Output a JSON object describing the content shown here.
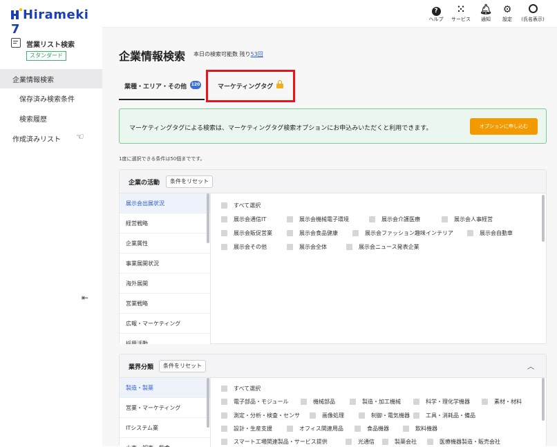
{
  "app": {
    "logo": "Hirameki 7"
  },
  "sidebar": {
    "title": "営業リスト検索",
    "badge": "スタンダード",
    "items": [
      {
        "label": "企業情報検索"
      },
      {
        "label": "保存済み検索条件"
      },
      {
        "label": "検索履歴"
      },
      {
        "label": "作成済みリスト"
      }
    ],
    "collapse_icon": "collapse-left-icon"
  },
  "topbar": {
    "items": [
      {
        "label": "ヘルプ",
        "icon": "help-icon"
      },
      {
        "label": "サービス",
        "icon": "grid-icon"
      },
      {
        "label": "通知",
        "icon": "bell-icon"
      },
      {
        "label": "設定",
        "icon": "gear-icon"
      },
      {
        "label": "(氏名表示)",
        "icon": "user-icon"
      }
    ]
  },
  "page": {
    "title": "企業情報検索",
    "quota_label": "本日の検索可能数 残り",
    "quota_value": "53回"
  },
  "tabs": [
    {
      "label": "業種・エリア・その他",
      "badge": "120"
    },
    {
      "label": "マーケティングタグ",
      "icon": "lock-icon"
    }
  ],
  "notice": {
    "text": "マーケティングタグによる検索は、マーケティングタグ検索オプションにお申込みいただくと利用できます。",
    "button": "オプションに申し込む"
  },
  "limit_note": "1度に選択できる条件は50個までです。",
  "panels": [
    {
      "title": "企業の活動",
      "reset": "条件をリセット",
      "categories": [
        "展示会出展状況",
        "経営戦略",
        "企業属性",
        "事業展開状況",
        "海外展開",
        "営業戦略",
        "広報・マーケティング",
        "採用活動"
      ],
      "select_all": "すべて選択",
      "options": [
        [
          "展示会通信IT",
          "展示会機械電子環境",
          "展示会介護医療",
          "展示会人事経営"
        ],
        [
          "展示会販促営業",
          "展示会食品健康",
          "展示会ファッション趣味インテリア",
          "展示会自動車"
        ],
        [
          "展示会その他",
          "展示会全体",
          "展示会ニュース発表企業"
        ]
      ]
    },
    {
      "title": "業界分類",
      "reset": "条件をリセット",
      "categories": [
        "製造・製薬",
        "営業・マーケティング",
        "ITシステム業",
        "小売・卸売・飲食"
      ],
      "select_all": "すべて選択",
      "options": [
        [
          "電子部品・モジュール",
          "機械部品",
          "製造・加工機械",
          "科学・理化学機器",
          "素材・材料"
        ],
        [
          "測定・分析・検査・センサ",
          "画像処理",
          "制御・電気機器",
          "工具・消耗品・備品"
        ],
        [
          "設計・生産支援",
          "オフィス関連用品",
          "食品機器",
          "飲料機器"
        ],
        [
          "スマート工場関連製品・サービス提供",
          "光通信",
          "製薬会社",
          "医療機器製造・販売会社"
        ]
      ]
    }
  ]
}
